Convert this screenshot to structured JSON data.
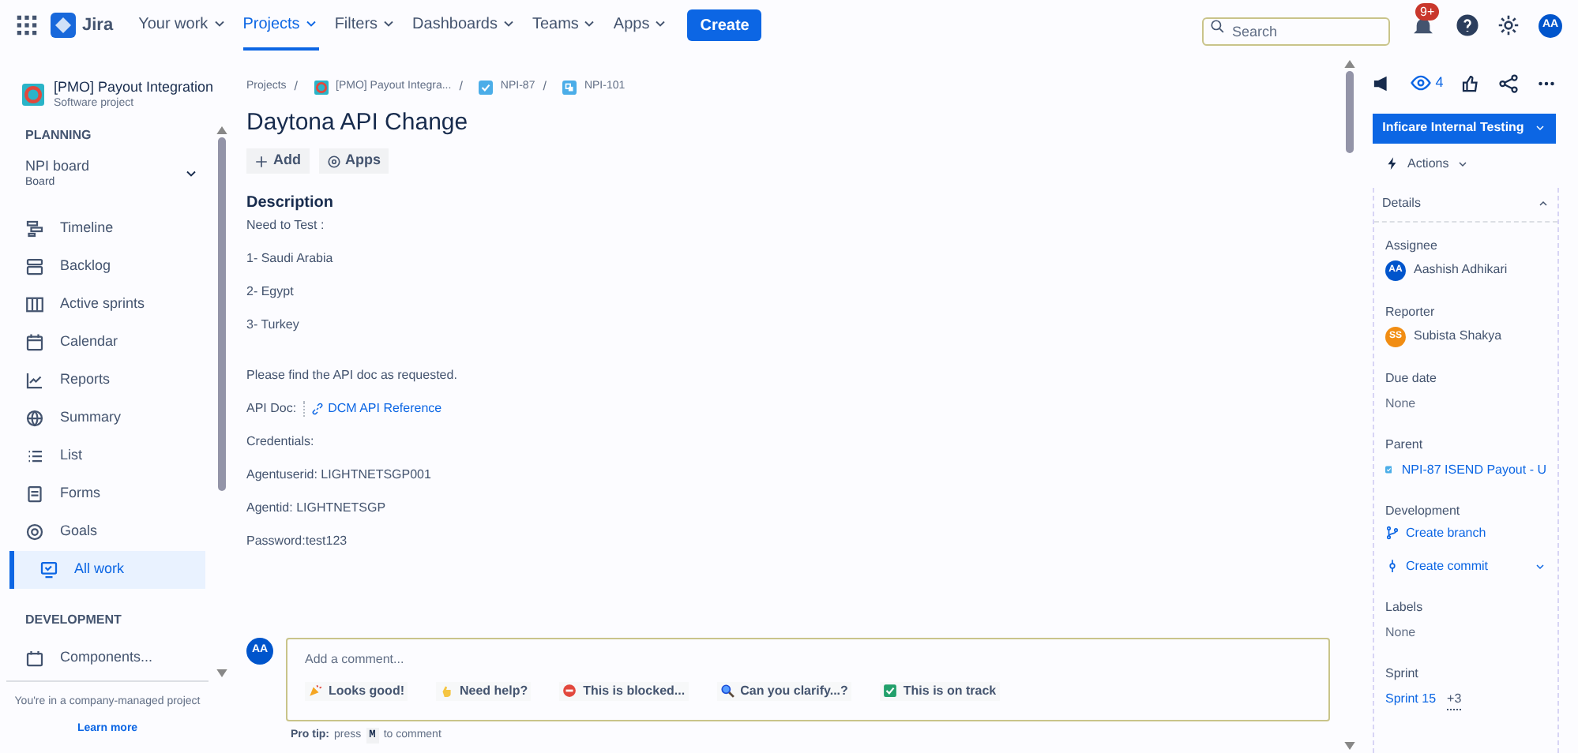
{
  "topbar": {
    "product": "Jira",
    "nav": [
      {
        "label": "Your work",
        "selected": false
      },
      {
        "label": "Projects",
        "selected": true
      },
      {
        "label": "Filters",
        "selected": false
      },
      {
        "label": "Dashboards",
        "selected": false
      },
      {
        "label": "Teams",
        "selected": false
      },
      {
        "label": "Apps",
        "selected": false
      }
    ],
    "create": "Create",
    "search": {
      "placeholder": "Search"
    },
    "notification_badge": "9+",
    "avatar": "AA"
  },
  "sidebar": {
    "project": {
      "name": "[PMO] Payout Integration",
      "type": "Software project"
    },
    "sections": [
      {
        "heading": "PLANNING",
        "items": [
          {
            "kind": "board",
            "label": "NPI board",
            "sublabel": "Board",
            "selected": false
          },
          {
            "kind": "timeline",
            "label": "Timeline",
            "selected": false
          },
          {
            "kind": "backlog",
            "label": "Backlog",
            "selected": false
          },
          {
            "kind": "sprints",
            "label": "Active sprints",
            "selected": false
          },
          {
            "kind": "calendar",
            "label": "Calendar",
            "selected": false
          },
          {
            "kind": "reports",
            "label": "Reports",
            "selected": false
          },
          {
            "kind": "summary",
            "label": "Summary",
            "selected": false
          },
          {
            "kind": "list",
            "label": "List",
            "selected": false
          },
          {
            "kind": "forms",
            "label": "Forms",
            "selected": false
          },
          {
            "kind": "goals",
            "label": "Goals",
            "selected": false
          },
          {
            "kind": "allwork",
            "label": "All work",
            "selected": true
          }
        ]
      },
      {
        "heading": "DEVELOPMENT",
        "items": [
          {
            "kind": "components",
            "label": "Components...",
            "selected": false
          }
        ]
      }
    ],
    "footer": "You're in a company-managed project",
    "learn_more": "Learn more"
  },
  "breadcrumbs": [
    {
      "kind": "project",
      "label": "Projects"
    },
    {
      "kind": "projecticon",
      "separator": "/",
      "label": "[PMO] Payout Integra..."
    },
    {
      "kind": "task",
      "separator": "/",
      "label": "NPI-87"
    },
    {
      "kind": "subtask",
      "separator": "/",
      "label": "NPI-101"
    }
  ],
  "issue": {
    "title": "Daytona API Change",
    "actions": [
      {
        "kind": "add",
        "label": "Add"
      },
      {
        "kind": "apps",
        "label": "Apps"
      }
    ],
    "description": {
      "heading": "Description",
      "lines": [
        {
          "text": "Need to Test :"
        },
        {
          "text": "1- Saudi Arabia"
        },
        {
          "text": "2- Egypt"
        },
        {
          "text": "3- Turkey"
        },
        {
          "text": "Please find the API doc as requested."
        },
        {
          "text": "API Doc:",
          "link": "DCM API Reference"
        },
        {
          "text": "Credentials:"
        },
        {
          "text": "Agentuserid: LIGHTNETSGP001"
        },
        {
          "text": "Agentid: LIGHTNETSGP"
        },
        {
          "text": "Password:test123"
        }
      ]
    }
  },
  "comment": {
    "avatar": "AA",
    "placeholder": "Add a comment...",
    "quick_replies": [
      {
        "kind": "party",
        "label": "Looks good!"
      },
      {
        "kind": "hand",
        "label": "Need help?"
      },
      {
        "kind": "blocked",
        "label": "This is blocked..."
      },
      {
        "kind": "magnifier",
        "label": "Can you clarify...?"
      },
      {
        "kind": "check",
        "label": "This is on track"
      }
    ],
    "tip": {
      "label": "Pro tip:",
      "before": "press",
      "key": "M",
      "after": "to comment"
    }
  },
  "details": {
    "watchers": "4",
    "status": "Inficare Internal Testing",
    "actions": "Actions",
    "heading": "Details",
    "expanded": true,
    "fields": [
      {
        "kind": "person",
        "label": "Assignee",
        "avatar": "AA",
        "color": "#0055cc",
        "value": "Aashish Adhikari"
      },
      {
        "kind": "person",
        "label": "Reporter",
        "avatar": "SS",
        "color": "#f18d13",
        "value": "Subista Shakya"
      },
      {
        "kind": "text",
        "label": "Due date",
        "value": "None"
      },
      {
        "kind": "parent",
        "label": "Parent",
        "value": "NPI-87 ISEND Payout - U"
      },
      {
        "kind": "development",
        "label": "Development",
        "branch": "Create branch",
        "commit": "Create commit"
      },
      {
        "kind": "text",
        "label": "Labels",
        "value": "None"
      },
      {
        "kind": "sprint",
        "label": "Sprint",
        "value": "Sprint 15",
        "extra": "+3"
      }
    ]
  }
}
